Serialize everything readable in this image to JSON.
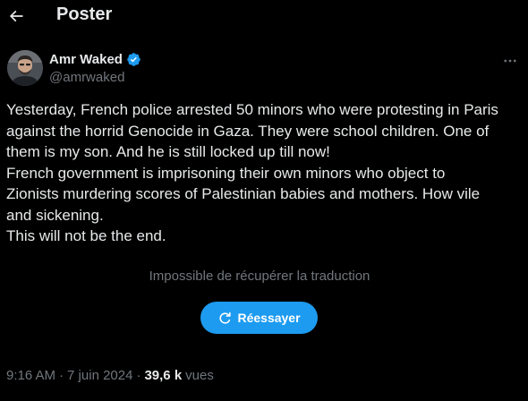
{
  "header": {
    "title": "Poster"
  },
  "author": {
    "name": "Amr Waked",
    "handle": "@amrwaked",
    "verified": true
  },
  "tweet": {
    "lines": [
      "Yesterday, French police arrested 50 minors who were protesting in Paris",
      "against the horrid Genocide in Gaza. They were school children. One of",
      "them is my son. And he is still locked up till now!",
      "French government is imprisoning their own minors who object to",
      "Zionists murdering scores of Palestinian babies and mothers. How vile",
      "and sickening.",
      "This will not be the end."
    ]
  },
  "translation": {
    "error_text": "Impossible de récupérer la traduction",
    "retry_label": "Réessayer"
  },
  "meta": {
    "time": "9:16 AM",
    "date": "7 juin 2024",
    "separator": "·",
    "views_count": "39,6 k",
    "views_label": "vues"
  },
  "colors": {
    "background": "#000000",
    "text": "#e7e9ea",
    "secondary": "#71767b",
    "accent": "#1d9bf0"
  },
  "icons": {
    "back": "back-arrow-icon",
    "verified": "verified-badge-icon",
    "more": "more-options-icon",
    "retry": "refresh-icon"
  }
}
